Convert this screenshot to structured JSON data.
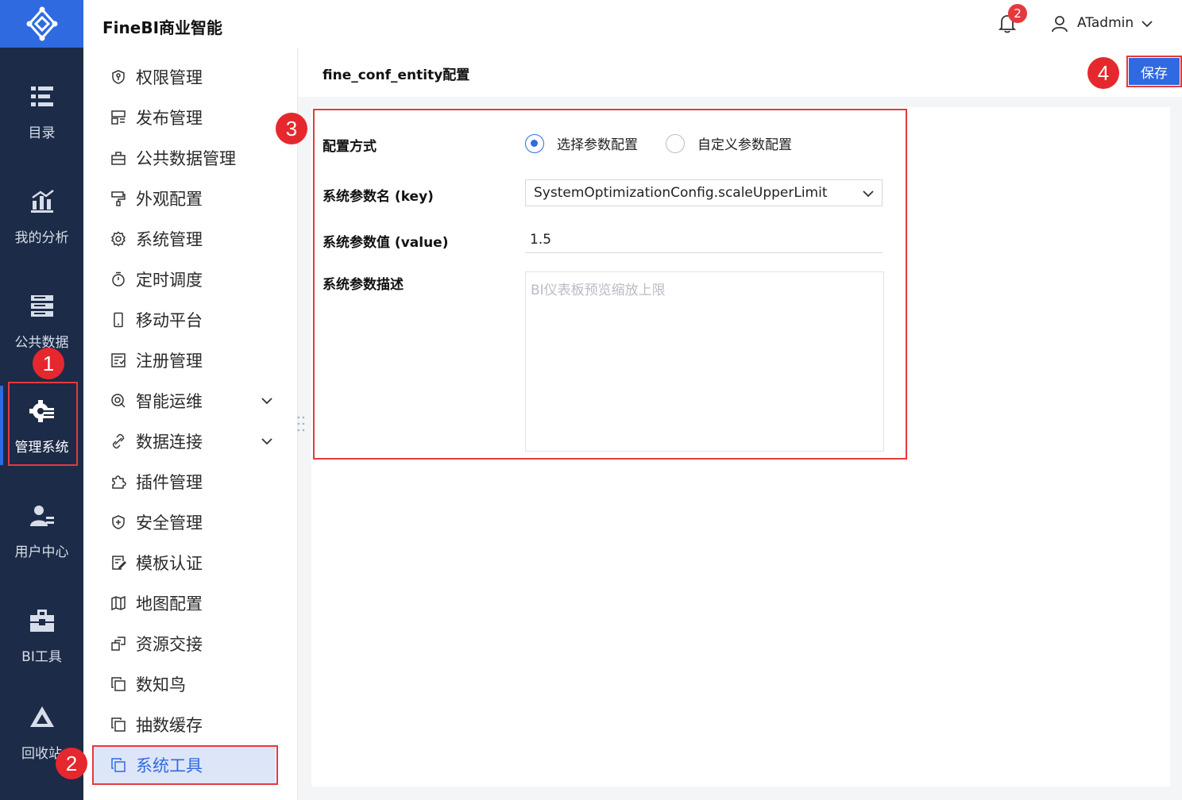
{
  "header": {
    "app_title": "FineBI商业智能",
    "notification_count": "2",
    "user_name": "ATadmin"
  },
  "rail": {
    "items": [
      {
        "label": "目录",
        "icon": "catalog-icon"
      },
      {
        "label": "我的分析",
        "icon": "analysis-chart-icon"
      },
      {
        "label": "公共数据",
        "icon": "public-data-icon"
      },
      {
        "label": "管理系统",
        "icon": "gear-manage-icon",
        "active": true
      },
      {
        "label": "用户中心",
        "icon": "user-center-icon"
      },
      {
        "label": "BI工具",
        "icon": "toolbox-icon"
      },
      {
        "label": "回收站",
        "icon": "recycle-icon"
      }
    ]
  },
  "menu": {
    "items": [
      {
        "label": "权限管理",
        "icon": "shield-key-icon"
      },
      {
        "label": "发布管理",
        "icon": "publish-icon"
      },
      {
        "label": "公共数据管理",
        "icon": "public-data-manage-icon"
      },
      {
        "label": "外观配置",
        "icon": "paint-roller-icon"
      },
      {
        "label": "系统管理",
        "icon": "gear-icon"
      },
      {
        "label": "定时调度",
        "icon": "timer-icon"
      },
      {
        "label": "移动平台",
        "icon": "mobile-icon"
      },
      {
        "label": "注册管理",
        "icon": "register-icon"
      },
      {
        "label": "智能运维",
        "icon": "ops-icon",
        "expandable": true
      },
      {
        "label": "数据连接",
        "icon": "link-icon",
        "expandable": true
      },
      {
        "label": "插件管理",
        "icon": "plugin-icon"
      },
      {
        "label": "安全管理",
        "icon": "security-icon"
      },
      {
        "label": "模板认证",
        "icon": "template-cert-icon"
      },
      {
        "label": "地图配置",
        "icon": "map-icon"
      },
      {
        "label": "资源交接",
        "icon": "resource-icon"
      },
      {
        "label": "数知鸟",
        "icon": "copy-icon"
      },
      {
        "label": "抽数缓存",
        "icon": "copy-icon"
      },
      {
        "label": "系统工具",
        "icon": "copy-icon",
        "selected": true
      }
    ]
  },
  "main": {
    "title": "fine_conf_entity配置",
    "save_label": "保存",
    "form": {
      "mode_label": "配置方式",
      "mode_options": [
        "选择参数配置",
        "自定义参数配置"
      ],
      "mode_selected": "选择参数配置",
      "key_label": "系统参数名 (key)",
      "key_value": "SystemOptimizationConfig.scaleUpperLimit",
      "value_label": "系统参数值 (value)",
      "value_value": "1.5",
      "desc_label": "系统参数描述",
      "desc_placeholder": "BI仪表板预览缩放上限"
    }
  },
  "annotations": {
    "steps": [
      "1",
      "2",
      "3",
      "4"
    ],
    "color": "#e5393c"
  },
  "colors": {
    "accent": "#2f6ae0",
    "rail_bg": "#1c2b47",
    "highlight": "#e5393c"
  }
}
